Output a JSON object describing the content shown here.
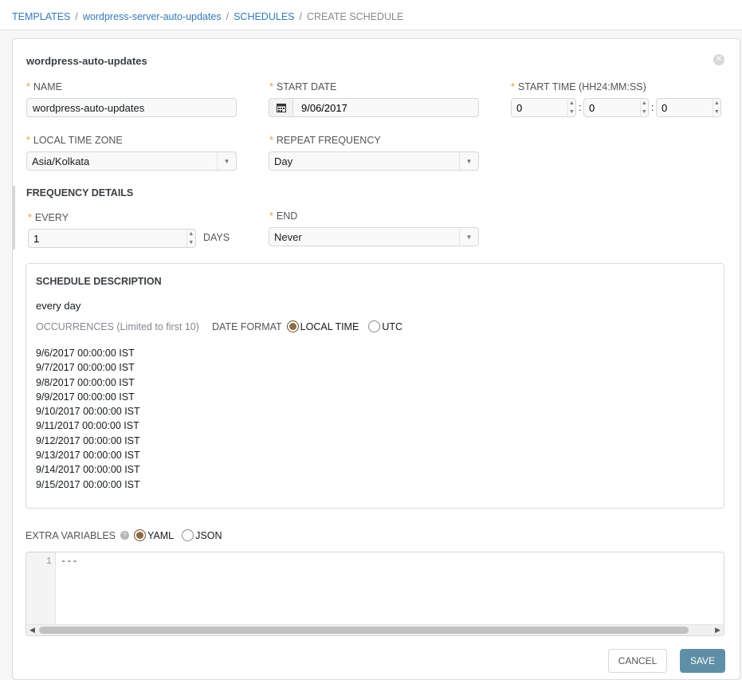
{
  "breadcrumb": {
    "items": [
      "TEMPLATES",
      "wordpress-server-auto-updates",
      "SCHEDULES"
    ],
    "current": "CREATE SCHEDULE",
    "separator": "/"
  },
  "form": {
    "title": "wordpress-auto-updates",
    "name_label": "NAME",
    "name_value": "wordpress-auto-updates",
    "start_date_label": "START DATE",
    "start_date_value": "9/06/2017",
    "start_time_label": "START TIME (HH24:MM:SS)",
    "start_time_hh": "0",
    "start_time_mm": "0",
    "start_time_ss": "0",
    "time_separator": ":",
    "timezone_label": "LOCAL TIME ZONE",
    "timezone_value": "Asia/Kolkata",
    "repeat_label": "REPEAT FREQUENCY",
    "repeat_value": "Day",
    "required_marker": "*"
  },
  "frequency": {
    "heading": "FREQUENCY DETAILS",
    "every_label": "EVERY",
    "every_value": "1",
    "every_unit": "DAYS",
    "end_label": "END",
    "end_value": "Never"
  },
  "schedule_description": {
    "heading": "SCHEDULE DESCRIPTION",
    "text": "every day",
    "occurrences_label": "OCCURRENCES",
    "occurrences_note": "(Limited to first 10)",
    "date_format_label": "DATE FORMAT",
    "options": [
      "LOCAL TIME",
      "UTC"
    ],
    "selected": "LOCAL TIME",
    "occurrences": [
      "9/6/2017 00:00:00 IST",
      "9/7/2017 00:00:00 IST",
      "9/8/2017 00:00:00 IST",
      "9/9/2017 00:00:00 IST",
      "9/10/2017 00:00:00 IST",
      "9/11/2017 00:00:00 IST",
      "9/12/2017 00:00:00 IST",
      "9/13/2017 00:00:00 IST",
      "9/14/2017 00:00:00 IST",
      "9/15/2017 00:00:00 IST"
    ]
  },
  "extra_variables": {
    "label": "EXTRA VARIABLES",
    "help_icon": "?",
    "options": [
      "YAML",
      "JSON"
    ],
    "selected": "YAML",
    "line_number": "1",
    "content": "---"
  },
  "buttons": {
    "cancel": "CANCEL",
    "save": "SAVE"
  },
  "icons": {
    "close": "close-icon",
    "calendar": "calendar-icon",
    "help": "help-icon"
  },
  "colors": {
    "link": "#337ab7",
    "required": "#e59c2e",
    "save_button": "#5f8fa6"
  }
}
